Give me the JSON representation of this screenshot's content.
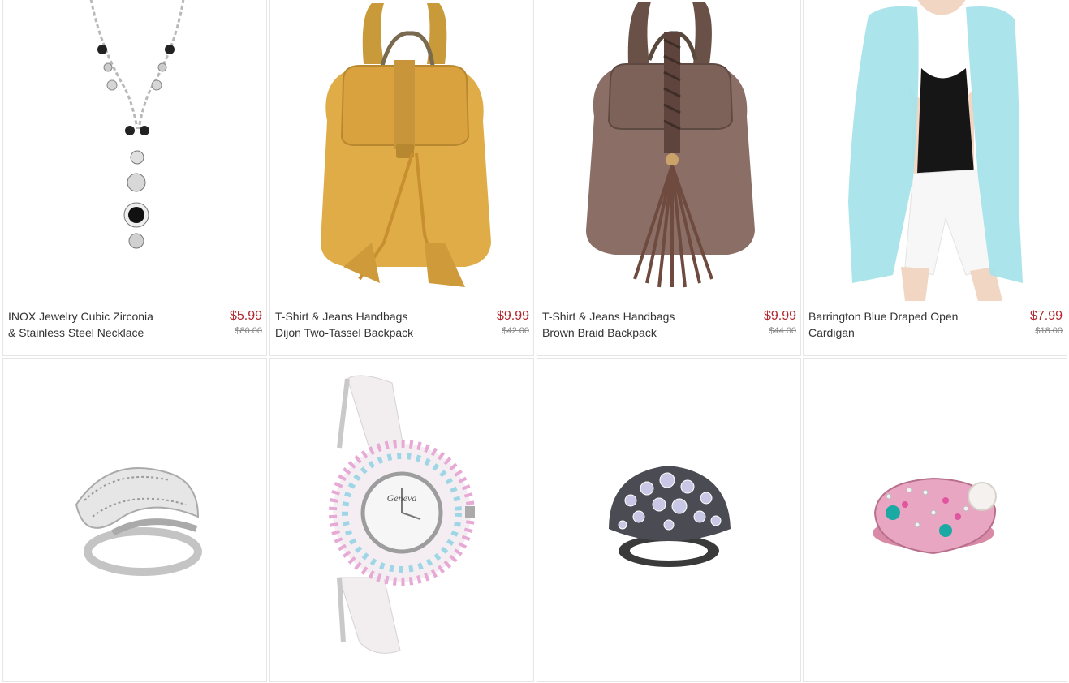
{
  "colors": {
    "price": "#b1262c",
    "title": "#333333",
    "original_price": "#888888",
    "card_border": "#e6e6e6"
  },
  "products": [
    {
      "title": "INOX Jewelry Cubic Zirconia\n& Stainless Steel Necklace",
      "price": "$5.99",
      "original_price": "$80.00",
      "image": "necklace-image"
    },
    {
      "title": "T-Shirt & Jeans Handbags\nDijon Two-Tassel Backpack",
      "price": "$9.99",
      "original_price": "$42.00",
      "image": "yellow-backpack-image"
    },
    {
      "title": "T-Shirt & Jeans Handbags\nBrown Braid Backpack",
      "price": "$9.99",
      "original_price": "$44.00",
      "image": "brown-backpack-image"
    },
    {
      "title": "Barrington Blue Draped Open\nCardigan",
      "price": "$7.99",
      "original_price": "$18.00",
      "image": "cardigan-image"
    },
    {
      "image": "silver-ring-image"
    },
    {
      "watch_brand": "Geneva",
      "image": "crystal-watch-image"
    },
    {
      "image": "dark-crystal-ring-image"
    },
    {
      "image": "pink-pearl-ring-image"
    }
  ]
}
